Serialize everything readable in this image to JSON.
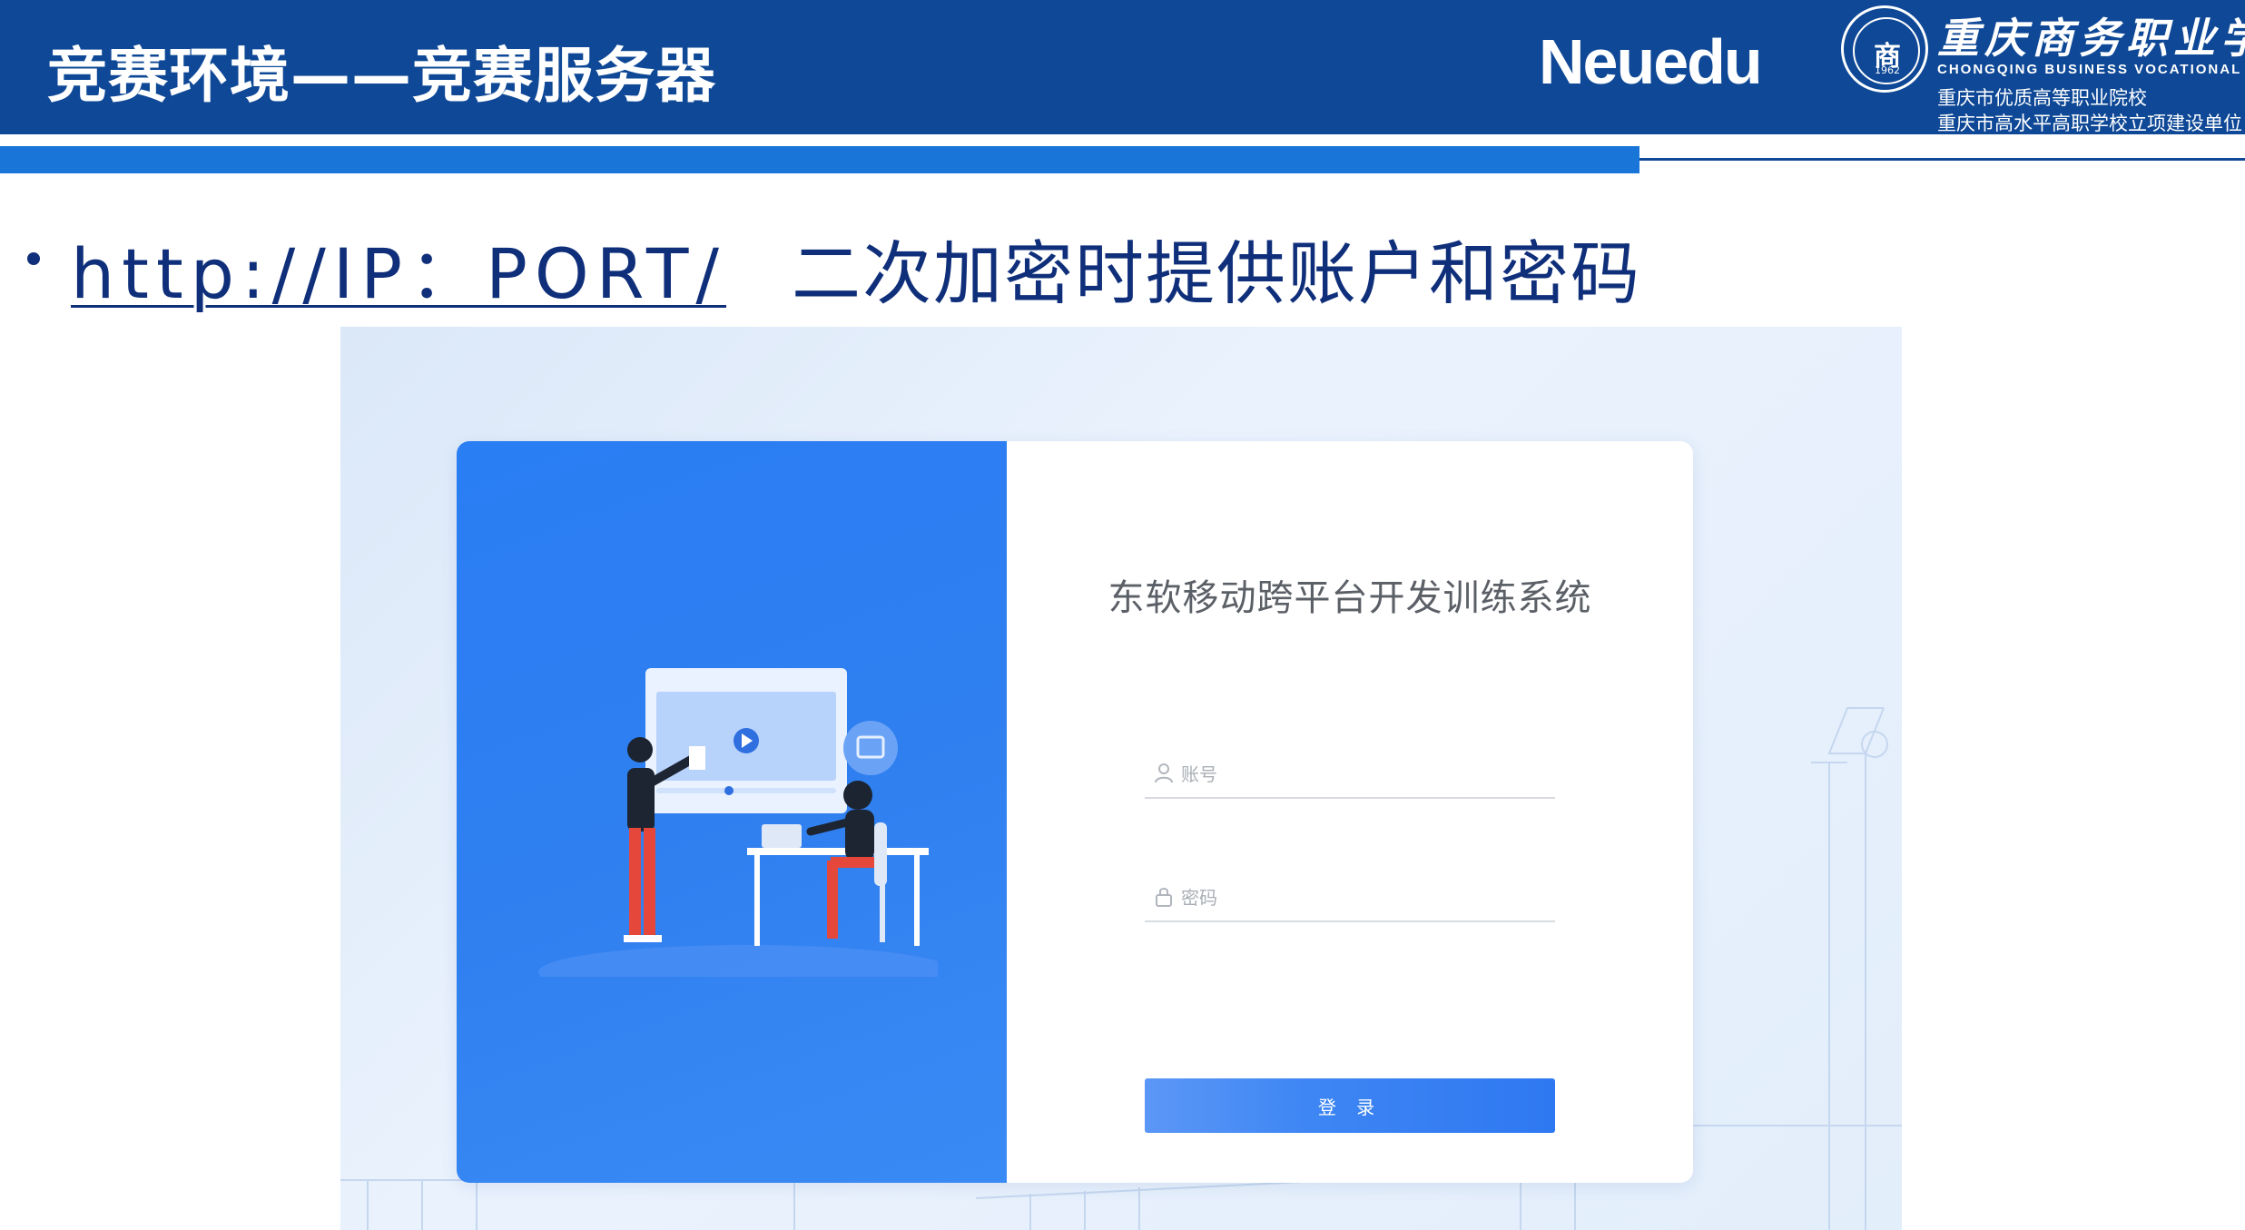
{
  "header": {
    "title": "竞赛环境——竞赛服务器",
    "brand": "Neuedu",
    "seal_text": "商",
    "seal_year": "1962",
    "school_name_cn": "重庆商务职业学院",
    "school_name_en": "CHONGQING BUSINESS VOCATIONAL COLLEGE",
    "school_line1": "重庆市优质高等职业院校",
    "school_line2": "重庆市高水平高职学校立项建设单位"
  },
  "bullet": {
    "link": "http://IP：PORT/",
    "text": "二次加密时提供账户和密码"
  },
  "login": {
    "system_title": "东软移动跨平台开发训练系统",
    "username_placeholder": "账号",
    "password_placeholder": "密码",
    "login_button": "登 录",
    "accent_color": "#2f7ff0"
  },
  "icons": {
    "user": "user-icon",
    "lock": "lock-icon",
    "play": "play-icon"
  }
}
